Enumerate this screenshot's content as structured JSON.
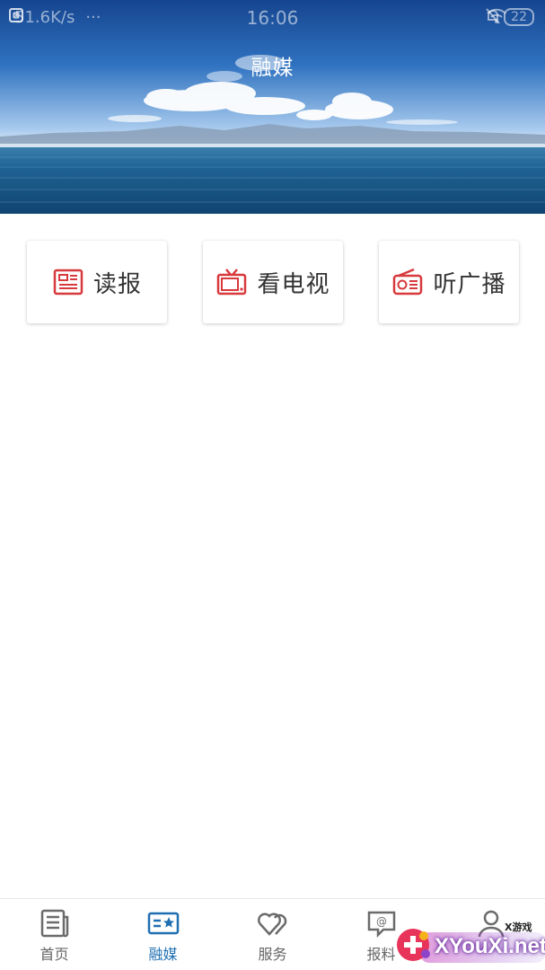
{
  "status_bar": {
    "network_speed": "51.6K/s",
    "menu_dots": "···",
    "time": "16:06",
    "battery": "22"
  },
  "header": {
    "title": "融媒"
  },
  "media_cards": [
    {
      "label": "读报",
      "icon": "newspaper-icon"
    },
    {
      "label": "看电视",
      "icon": "tv-icon"
    },
    {
      "label": "听广播",
      "icon": "radio-icon"
    }
  ],
  "tabbar": {
    "items": [
      {
        "label": "首页",
        "icon": "news-icon",
        "active": false
      },
      {
        "label": "融媒",
        "icon": "media-star-icon",
        "active": true
      },
      {
        "label": "服务",
        "icon": "heart-icon",
        "active": false
      },
      {
        "label": "报料",
        "icon": "chat-at-icon",
        "active": false
      }
    ]
  },
  "watermark": {
    "text": "XYouXi.net",
    "small_text": "X游戏"
  },
  "colors": {
    "accent_red": "#d8393c",
    "active_tab_blue": "#1f6fb2",
    "inactive_tab_gray": "#666666"
  }
}
